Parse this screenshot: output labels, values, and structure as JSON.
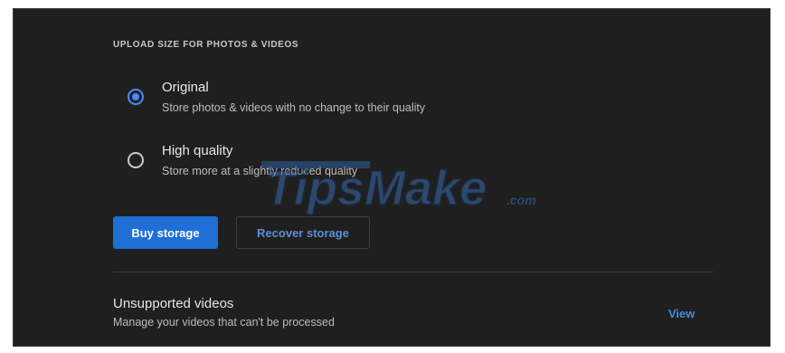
{
  "section": {
    "title": "UPLOAD SIZE FOR PHOTOS & VIDEOS"
  },
  "options": [
    {
      "title": "Original",
      "description": "Store photos & videos with no change to their quality",
      "selected": true
    },
    {
      "title": "High quality",
      "description": "Store more at a slightly reduced quality",
      "selected": false
    }
  ],
  "buttons": {
    "buy_storage": "Buy storage",
    "recover_storage": "Recover storage"
  },
  "unsupported": {
    "title": "Unsupported videos",
    "description": "Manage your videos that can't be processed",
    "view_label": "View"
  },
  "watermark": {
    "text": "TipsMake",
    "suffix": ".com"
  },
  "colors": {
    "background": "#1f1f1f",
    "accent": "#1f6fd6",
    "link": "#4a88e0",
    "radio_selected": "#4a8af4"
  }
}
